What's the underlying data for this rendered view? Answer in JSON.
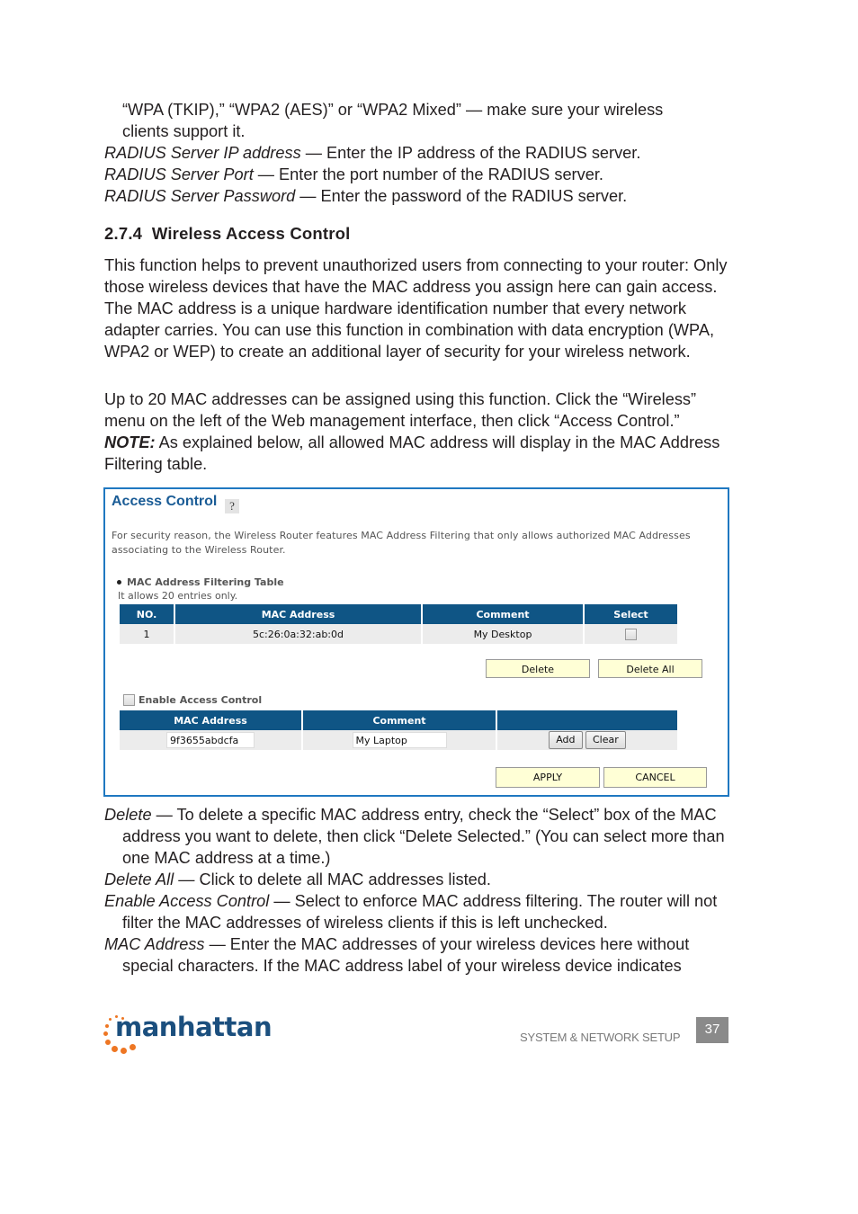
{
  "top_text": {
    "continuation_line1": "“WPA (TKIP),” “WPA2 (AES)” or “WPA2 Mixed” — make sure your wireless",
    "continuation_line2": "clients support it.",
    "items": [
      {
        "term": "RADIUS Server IP address",
        "desc": " — Enter the IP address of the RADIUS server."
      },
      {
        "term": "RADIUS Server Port",
        "desc": " — Enter the port number of the RADIUS server."
      },
      {
        "term": "RADIUS Server Password",
        "desc": " — Enter the password of the RADIUS server."
      }
    ]
  },
  "section": {
    "heading": "2.7.4  Wireless Access Control",
    "para1": "This function helps to prevent unauthorized users from connecting to your router: Only those wireless devices that have the MAC address you assign here can gain access. The MAC address is a unique hardware identification number that every network adapter carries. You can use this function in combination with data encryption (WPA, WPA2 or WEP) to create an additional layer of security for your wireless network.",
    "para2": "Up to 20 MAC addresses can be assigned using this function. Click the “Wireless” menu on the left of the Web management interface, then click “Access Control.”",
    "note_label": "NOTE:",
    "note_text": " As explained below, all allowed MAC address will display in the MAC Address Filtering table."
  },
  "screenshot": {
    "title": "Access Control",
    "help_icon": "help-icon",
    "description": "For security reason, the Wireless Router features MAC Address Filtering that only allows authorized MAC Addresses associating to the Wireless Router.",
    "filter_table_label": "MAC Address Filtering Table",
    "filter_table_sub": "It allows 20 entries only.",
    "filter_table": {
      "headers": [
        "NO.",
        "MAC Address",
        "Comment",
        "Select"
      ],
      "rows": [
        {
          "no": "1",
          "mac": "5c:26:0a:32:ab:0d",
          "comment": "My Desktop",
          "selected": false
        }
      ]
    },
    "delete_label": "Delete",
    "delete_all_label": "Delete All",
    "enable_label": "Enable Access Control",
    "enable_checked": false,
    "add_table": {
      "headers": [
        "MAC Address",
        "Comment",
        ""
      ],
      "mac_value": "9f3655abdcfa",
      "comment_value": "My Laptop"
    },
    "add_label": "Add",
    "clear_label": "Clear",
    "apply_label": "APPLY",
    "cancel_label": "CANCEL"
  },
  "bottom_text": {
    "items": [
      {
        "term": "Delete",
        "desc": " — To delete a specific MAC address entry, check the “Select” box of the MAC address you want to delete, then click “Delete Selected.” (You can select more than one MAC address at a time.)"
      },
      {
        "term": "Delete All",
        "desc": " — Click to delete all MAC addresses listed."
      },
      {
        "term": "Enable Access Control",
        "desc": " — Select to enforce MAC address filtering. The router will not filter the MAC addresses of wireless clients if this is left unchecked."
      },
      {
        "term": "MAC Address",
        "desc": " — Enter the MAC addresses of your wireless devices here without special characters. If the MAC address label of your wireless device indicates"
      }
    ]
  },
  "footer": {
    "brand": "manhattan",
    "section_label": "SYSTEM & NETWORK SETUP",
    "page_number": "37",
    "brand_color": "#1b4f7e",
    "accent_color": "#ee7623"
  }
}
